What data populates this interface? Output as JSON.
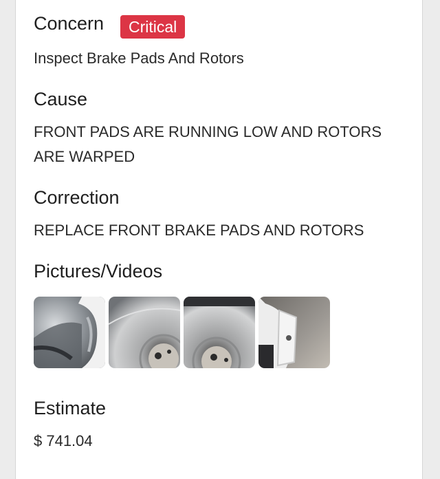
{
  "concern": {
    "heading": "Concern",
    "badge": "Critical",
    "badge_color": "#dc3545",
    "text": "Inspect Brake Pads And Rotors"
  },
  "cause": {
    "heading": "Cause",
    "line1": "FRONT PADS ARE RUNNING LOW AND ROTORS",
    "line2": "ARE WARPED"
  },
  "correction": {
    "heading": "Correction",
    "text": "REPLACE FRONT BRAKE PADS AND ROTORS"
  },
  "media": {
    "heading": "Pictures/Videos",
    "thumbnails": [
      {
        "icon": "brake-caliper-photo"
      },
      {
        "icon": "brake-rotor-photo"
      },
      {
        "icon": "brake-rotor-photo"
      },
      {
        "icon": "brake-caliper-photo"
      }
    ]
  },
  "estimate": {
    "heading": "Estimate",
    "amount": "$ 741.04"
  }
}
